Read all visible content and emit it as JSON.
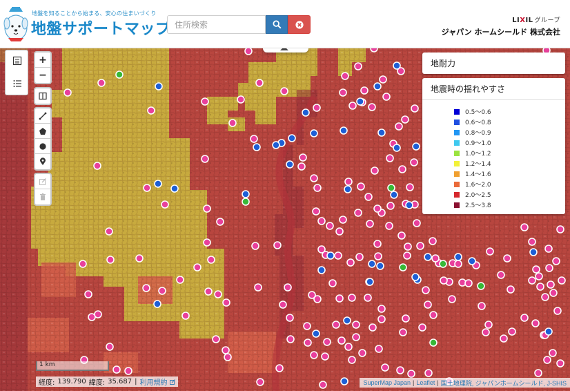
{
  "header": {
    "tagline": "地盤を知ることから始まる、安心の住まいづくり",
    "title": "地盤サポートマップ",
    "brand_logo": {
      "main_before": "LI",
      "main_x": "X",
      "main_after": "IL",
      "sub": "グループ"
    },
    "company": "ジャパン ホームシールド 株式会社"
  },
  "search": {
    "placeholder": "住所検索",
    "search_icon": "search-icon",
    "clear_icon": "close-icon"
  },
  "map_controls": {
    "zoom_in": "+",
    "zoom_out": "−",
    "icons": [
      "list-icon",
      "layers-list-icon",
      "columns-icon",
      "draw-line-icon",
      "draw-polygon-icon",
      "draw-circle-icon",
      "draw-marker-icon",
      "edit-icon",
      "delete-icon"
    ]
  },
  "panels": {
    "soil_strength": "地耐力",
    "shaking": {
      "title": "地震時の揺れやすさ",
      "legend": [
        {
          "label": "0.5〜0.6",
          "color": "#0000d6"
        },
        {
          "label": "0.6〜0.8",
          "color": "#1f4fe0"
        },
        {
          "label": "0.8〜0.9",
          "color": "#2196f3"
        },
        {
          "label": "0.9〜1.0",
          "color": "#3fc9ef"
        },
        {
          "label": "1.0〜1.2",
          "color": "#9be33f"
        },
        {
          "label": "1.2〜1.4",
          "color": "#f2f23a"
        },
        {
          "label": "1.4〜1.6",
          "color": "#f0a030"
        },
        {
          "label": "1.6〜2.0",
          "color": "#ea6a3a"
        },
        {
          "label": "2.0〜2.5",
          "color": "#d6282d"
        },
        {
          "label": "2.5〜3.8",
          "color": "#8b1030"
        }
      ]
    }
  },
  "map": {
    "scale": "1 km",
    "longitude_label": "経度:",
    "longitude": "139.790",
    "latitude_label": "緯度:",
    "latitude": "35.687",
    "terms_link": "利用規約",
    "attribution": [
      "SuperMap Japan",
      "|",
      "Leaflet",
      "|",
      "国土地理院, ジャパンホームシールド, J-SHIS"
    ],
    "colors": {
      "red_zone": "#b8463f",
      "yellow_zone": "#c9b23e",
      "marker_pink": "#e8409c",
      "marker_blue": "#1d5fd6",
      "marker_green": "#37b837"
    }
  }
}
